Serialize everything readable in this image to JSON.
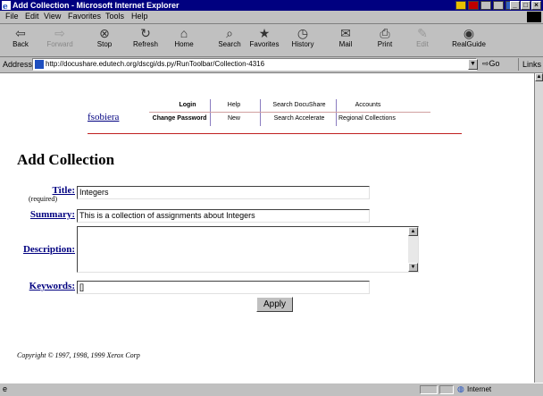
{
  "window": {
    "title": "Add Collection - Microsoft Internet Explorer",
    "controls": [
      "_",
      "□",
      "×"
    ]
  },
  "menu": [
    "File",
    "Edit",
    "View",
    "Favorites",
    "Tools",
    "Help"
  ],
  "toolbar": {
    "items": [
      {
        "label": "Back",
        "icon": "back-arrow",
        "glyph": "⇦"
      },
      {
        "label": "Forward",
        "icon": "forward-arrow",
        "glyph": "⇨"
      },
      {
        "label": "Stop",
        "icon": "stop",
        "glyph": "⊗"
      },
      {
        "label": "Refresh",
        "icon": "refresh",
        "glyph": "↻"
      },
      {
        "label": "Home",
        "icon": "home",
        "glyph": "⌂"
      },
      {
        "label": "Search",
        "icon": "search",
        "glyph": "⌕"
      },
      {
        "label": "Favorites",
        "icon": "favorites",
        "glyph": "★"
      },
      {
        "label": "History",
        "icon": "history",
        "glyph": "◷"
      },
      {
        "label": "Mail",
        "icon": "mail",
        "glyph": "✉"
      },
      {
        "label": "Print",
        "icon": "print",
        "glyph": "⎙"
      },
      {
        "label": "Edit",
        "icon": "edit",
        "glyph": "✎"
      },
      {
        "label": "RealGuide",
        "icon": "realguide",
        "glyph": "◉"
      }
    ]
  },
  "address": {
    "label": "Address",
    "url": "http://docushare.edutech.org/dscgi/ds.py/RunToolbar/Collection-4316",
    "go_label": "Go",
    "links_label": "Links"
  },
  "docushare_nav": {
    "user": "fsobiera",
    "row1": [
      "Login",
      "Help",
      "Search DocuShare",
      "Accounts"
    ],
    "row2": [
      "Change Password",
      "New",
      "Search Accelerate",
      "Regional Collections"
    ]
  },
  "page": {
    "title": "Add Collection",
    "fields": {
      "title_label": "Title:",
      "title_required": "(required)",
      "title_value": "Integers",
      "summary_label": "Summary:",
      "summary_value": "This is a collection of assignments about Integers",
      "description_label": "Description:",
      "description_value": "",
      "keywords_label": "Keywords:",
      "keywords_value": "[]"
    },
    "apply_label": "Apply",
    "copyright": "Copyright © 1997, 1998, 1999 Xerox Corp"
  },
  "status": {
    "zone": "Internet"
  }
}
